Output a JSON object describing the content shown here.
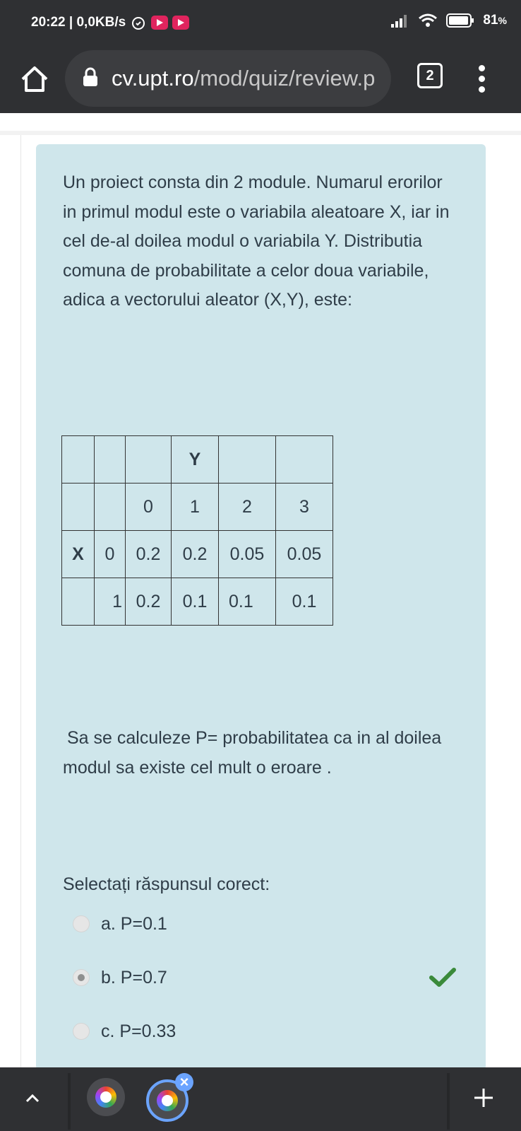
{
  "status_bar": {
    "time": "20:22 | 0,0KB/s",
    "battery": "81",
    "battery_unit": "%"
  },
  "browser": {
    "url_domain": "cv.upt.ro",
    "url_path": "/mod/quiz/review.p",
    "tab_count": "2"
  },
  "question": {
    "text": "Un proiect consta din 2 module. Numarul erorilor in primul modul este  o variabila aleatoare X, iar in cel de-al doilea modul o variabila Y. Distributia comuna de probabilitate a celor doua variabile, adica a vectorului aleator (X,Y), este:",
    "table": {
      "y_label": "Y",
      "x_label": "X",
      "y_values": [
        "0",
        "1",
        "2",
        "3"
      ],
      "rows": [
        {
          "x": "0",
          "p": [
            "0.2",
            "0.2",
            "0.05",
            "0.05"
          ]
        },
        {
          "x": "1",
          "p": [
            "0.2",
            "0.1",
            "0.1",
            "0.1"
          ]
        }
      ]
    },
    "ask": "Sa se calculeze P= probabilitatea ca in al doilea modul sa existe cel mult o eroare ."
  },
  "answer_prompt": "Selectați răspunsul corect:",
  "options": [
    {
      "label": "a. P=0.1",
      "selected": false
    },
    {
      "label": "b. P=0.7",
      "selected": true,
      "correct": true
    },
    {
      "label": "c. P=0.33",
      "selected": false
    }
  ],
  "colors": {
    "chrome_dark": "#2f3033",
    "card_bg": "#cfe6eb",
    "text": "#2f3d48",
    "check_green": "#3a8a3a",
    "tab_highlight": "#6ba4ff"
  }
}
